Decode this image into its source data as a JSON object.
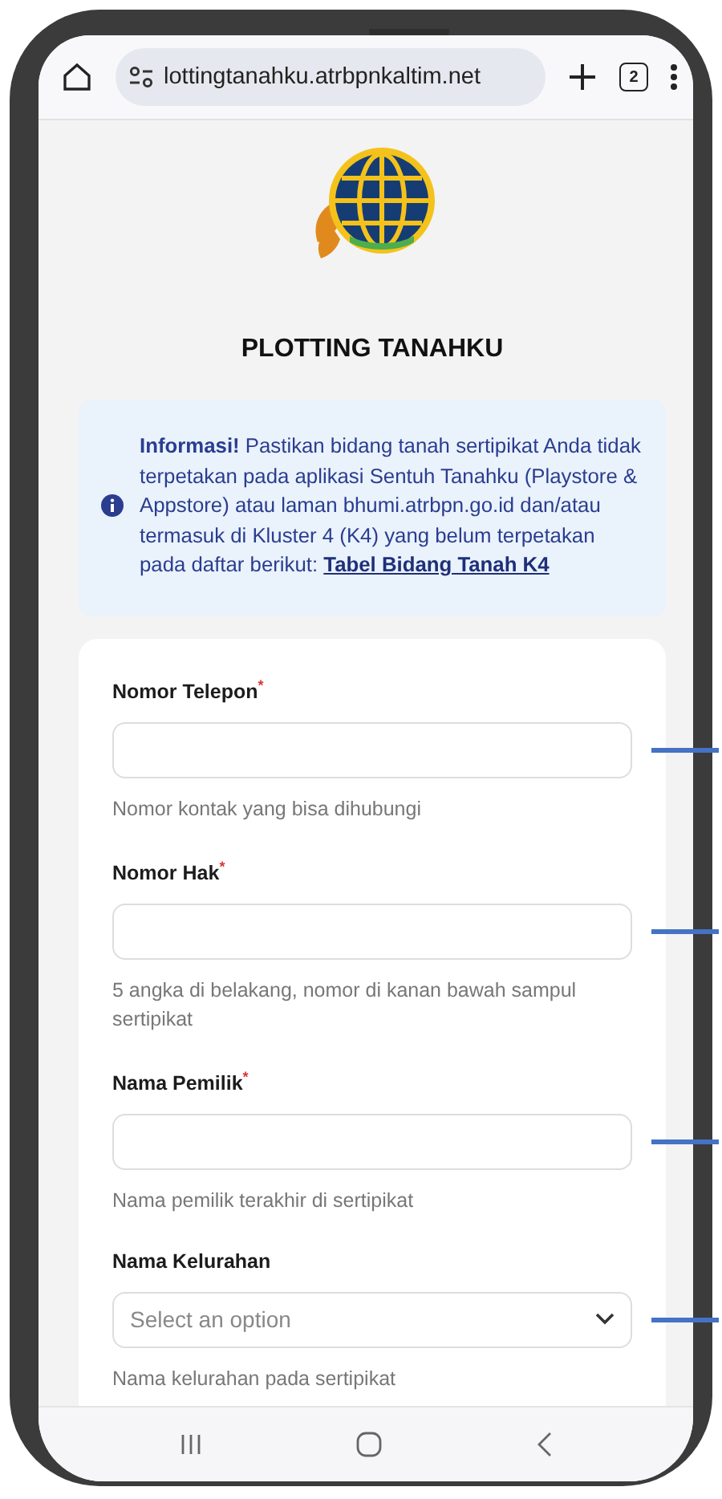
{
  "browser": {
    "url": "lottingtanahku.atrbpnkaltim.net",
    "tab_count": "2"
  },
  "page": {
    "title": "PLOTTING TANAHKU"
  },
  "info": {
    "text": "**Informasi!** Pastikan bidang tanah sertipikat Anda tidak terpetakan pada aplikasi Sentuh Tanahku (Playstore & Appstore) atau laman bhumi.atrbpn.go.id dan/atau termasuk di Kluster 4 (K4) yang belum terpetakan pada daftar berikut: ",
    "link": "Tabel Bidang Tanah K4"
  },
  "form": {
    "fields": [
      {
        "kind": "text",
        "label": "Nomor Telepon",
        "required_mark": "*",
        "hint": "Nomor kontak yang bisa dihubungi"
      },
      {
        "kind": "text",
        "label": "Nomor Hak",
        "required_mark": "*",
        "hint": "5 angka di belakang, nomor di kanan bawah sampul sertipikat"
      },
      {
        "kind": "text",
        "label": "Nama Pemilik",
        "required_mark": "*",
        "hint": "Nama pemilik terakhir di sertipikat"
      },
      {
        "kind": "select",
        "label": "Nama Kelurahan",
        "placeholder": "Select an option",
        "hint": "Nama kelurahan pada sertipikat"
      }
    ]
  }
}
